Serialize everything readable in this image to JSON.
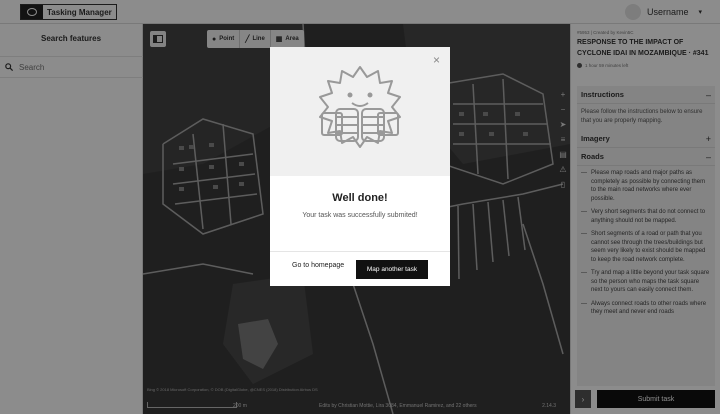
{
  "header": {
    "logo_text": "Tasking Manager",
    "username": "Username",
    "caret": "▾"
  },
  "left_panel": {
    "title": "Search features",
    "search_placeholder": "Search"
  },
  "map": {
    "tools": [
      {
        "icon": "point-icon",
        "label": "Point"
      },
      {
        "icon": "line-icon",
        "label": "Line"
      },
      {
        "icon": "area-icon",
        "label": "Area"
      }
    ],
    "attribution": "Bing © 2018 Microsoft Corporation, © DOB (DigitalGlobe, @CNES (2018) Distribution Airbus DS",
    "scale_label": "200 m",
    "edits_text": "Edits by Christian Mottie, Lira 3084, Emmanuel Ramirez, and 22 others",
    "version": "2.14.3",
    "label_a": "A",
    "label_aa": "AÅ"
  },
  "right_panel": {
    "meta": "#5953 | Created by Kevin5C",
    "project_title": "RESPONSE TO THE IMPACT OF CYCLONE IDAI IN MOZAMBIQUE · #341",
    "timer": "1 hour 59 minutes left",
    "instructions_title": "Instructions",
    "instructions_sign": "–",
    "instructions_text": "Please follow the instructions below to ensure that you are properly mapping.",
    "imagery_title": "Imagery",
    "imagery_sign": "+",
    "roads_title": "Roads",
    "roads_sign": "–",
    "bullets": [
      "Please map roads and major paths as completely as possible by connecting them to the main road networks where ever possible.",
      "Very short segments that do not connect to anything should not be mapped.",
      "Short segments of a road or path that you cannot see through the trees/buildings but seem very likely to exist should be mapped to keep the road network complete.",
      "Try and map a little beyond your task square so the person who maps the task square next to yours can easily connect them.",
      "Always connect roads to other roads where they meet and never end roads"
    ],
    "submit_label": "Submit task",
    "arrow": "›"
  },
  "modal": {
    "close": "×",
    "title": "Well done!",
    "message": "Your task was successfully submited!",
    "home_label": "Go to homepage",
    "another_label": "Map another task"
  },
  "colors": {
    "overlay": "rgba(0,0,0,0.45)",
    "primary_button": "#111111",
    "map_bg": "#3d3d3d"
  }
}
